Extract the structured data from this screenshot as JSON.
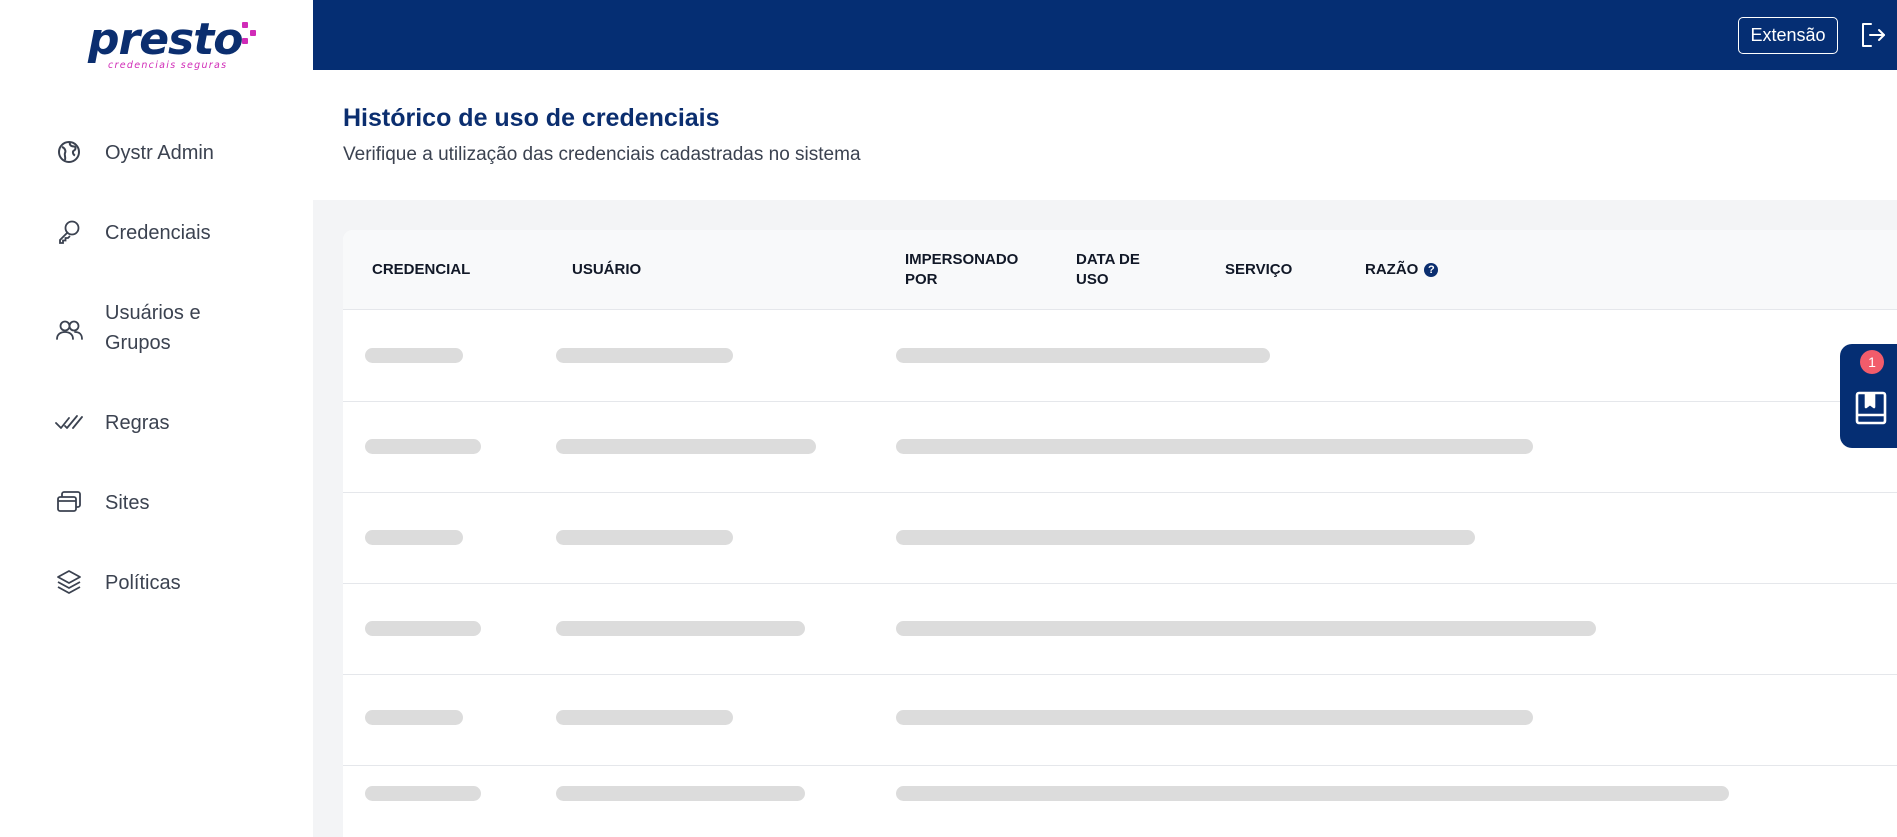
{
  "brand": {
    "name": "presto",
    "tagline": "credenciais seguras",
    "accent": "#d02bb7",
    "primary": "#052e73"
  },
  "sidebar": {
    "items": [
      {
        "label": "Oystr Admin",
        "icon": "globe-icon"
      },
      {
        "label": "Credenciais",
        "icon": "key-icon"
      },
      {
        "label": "Usuários e Grupos",
        "icon": "users-icon"
      },
      {
        "label": "Regras",
        "icon": "double-check-icon"
      },
      {
        "label": "Sites",
        "icon": "windows-icon"
      },
      {
        "label": "Políticas",
        "icon": "layers-icon"
      }
    ]
  },
  "topbar": {
    "extension_label": "Extensão",
    "logout_icon": "logout-icon"
  },
  "page": {
    "title": "Histórico de uso de credenciais",
    "subtitle": "Verifique a utilização das credenciais cadastradas no sistema"
  },
  "table": {
    "columns": [
      "CREDENCIAL",
      "USUÁRIO",
      "IMPERSONADO POR",
      "DATA DE USO",
      "SERVIÇO",
      "RAZÃO"
    ],
    "loading": true
  },
  "widget": {
    "badge_count": "1",
    "icon": "book-icon"
  }
}
